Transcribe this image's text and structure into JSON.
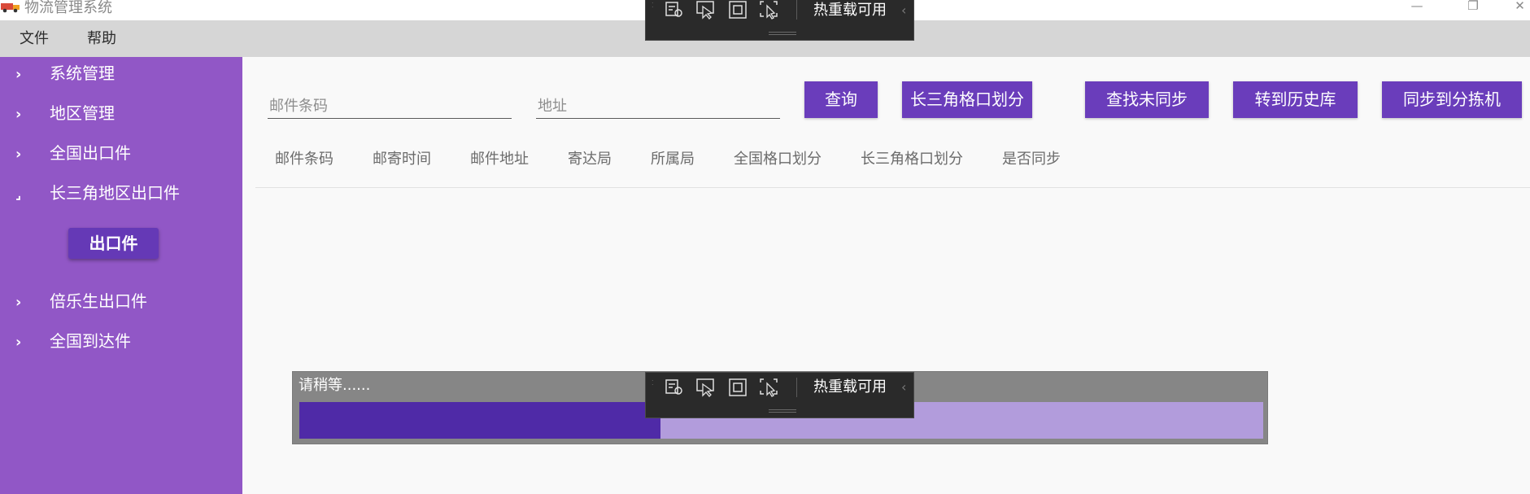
{
  "window": {
    "title": "物流管理系统",
    "minimize_glyph": "—",
    "restore_glyph": "❐",
    "close_glyph": "✕"
  },
  "menu": {
    "items": [
      {
        "label": "文件"
      },
      {
        "label": "帮助"
      }
    ]
  },
  "sidebar": {
    "items": [
      {
        "label": "系统管理",
        "chevron": "›",
        "expanded": false
      },
      {
        "label": "地区管理",
        "chevron": "›",
        "expanded": false
      },
      {
        "label": "全国出口件",
        "chevron": "›",
        "expanded": false
      },
      {
        "label": "长三角地区出口件",
        "chevron": "⌟",
        "expanded": true
      },
      {
        "label": "倍乐生出口件",
        "chevron": "›",
        "expanded": false
      },
      {
        "label": "全国到达件",
        "chevron": "›",
        "expanded": false
      }
    ],
    "sub_item_label": "出口件"
  },
  "search": {
    "barcode_placeholder": "邮件条码",
    "address_placeholder": "地址"
  },
  "toolbar": {
    "query": "查询",
    "partition": "长三角格口划分",
    "find_unsynced": "查找未同步",
    "to_history": "转到历史库",
    "sync_sorter": "同步到分拣机"
  },
  "table": {
    "columns": [
      "邮件条码",
      "邮寄时间",
      "邮件地址",
      "寄达局",
      "所属局",
      "全国格口划分",
      "长三角格口划分",
      "是否同步"
    ],
    "rows": []
  },
  "loading": {
    "text": "请稍等......",
    "progress_percent": 37.5
  },
  "devtools": {
    "label": "热重载可用",
    "icons": [
      "live-visual-tree-icon",
      "select-element-icon",
      "display-layout-adorners-icon",
      "track-focused-element-icon"
    ]
  },
  "colors": {
    "sidebar": "#9157c6",
    "accent": "#6a3dbb",
    "progress_fill": "#4f2aa7",
    "progress_track": "#b29cdc"
  }
}
